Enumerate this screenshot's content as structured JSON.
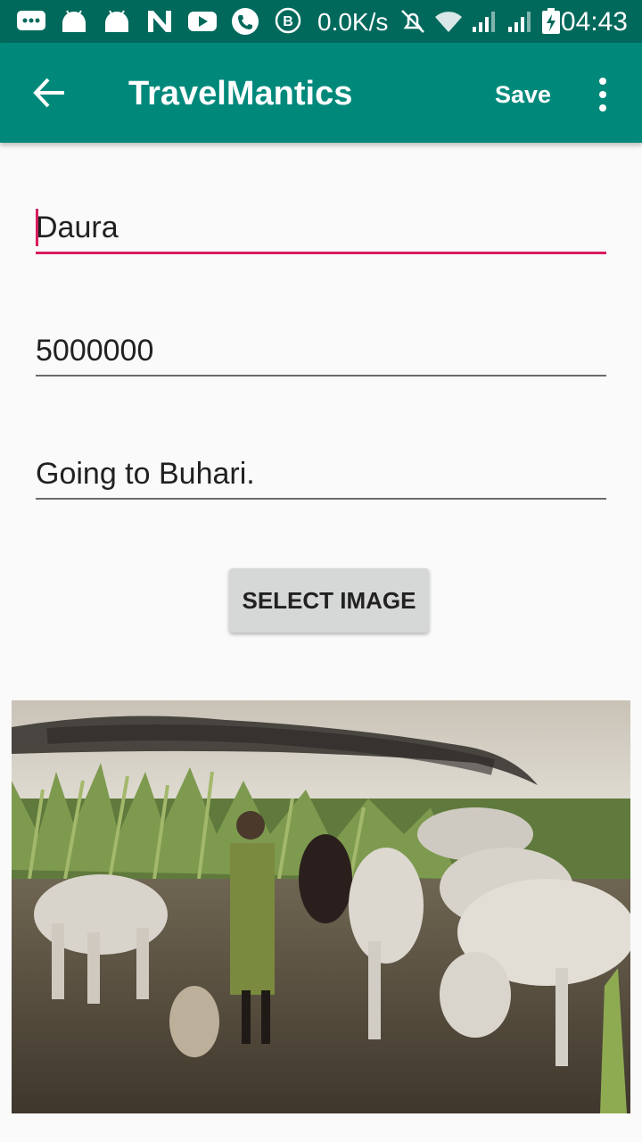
{
  "status_bar": {
    "left_icons": [
      "message-icon",
      "android-icon",
      "android-icon",
      "n-icon",
      "youtube-icon",
      "phone-icon",
      "b-icon"
    ],
    "network_speed": "0.0K/s",
    "right_icons": [
      "mute-icon",
      "wifi-icon",
      "signal-icon",
      "signal-icon",
      "battery-charging-icon"
    ],
    "time": "04:43",
    "background": "#00695c"
  },
  "app_bar": {
    "title": "TravelMantics",
    "save_label": "Save",
    "background": "#00897b"
  },
  "form": {
    "title_value": "Daura",
    "price_value": "5000000",
    "description_value": "Going to Buhari.",
    "accent": "#d81b60"
  },
  "select_image_label": "SELECT IMAGE",
  "photo": {
    "subject": "herder-with-cattle-photo"
  }
}
